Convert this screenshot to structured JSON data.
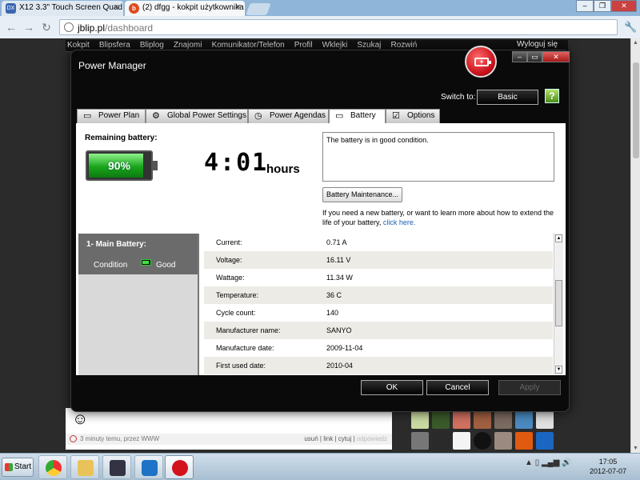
{
  "browser": {
    "tabs": [
      {
        "label": "X12 3.3\" Touch Screen Quad",
        "prefix": "DX"
      },
      {
        "label": "(2) dfgg - kokpit użytkownika"
      }
    ],
    "url_host": "jblip.pl",
    "url_path": "/dashboard"
  },
  "site": {
    "nav": [
      "Kokpit",
      "Blipsfera",
      "Bliplog",
      "Znajomi",
      "Komunikator/Telefon",
      "Profil",
      "Wklejki",
      "Szukaj",
      "Rozwiń"
    ],
    "logout": "Wyloguj się",
    "post": {
      "meta": "3 minuty temu, przez WWW",
      "actions": [
        "usuń",
        "link",
        "cytuj",
        "odpowiedz"
      ]
    }
  },
  "power_manager": {
    "title": "Power Manager",
    "switch_to_label": "Switch to:",
    "switch_button": "Basic",
    "help_icon_glyph": "?",
    "tabs": [
      {
        "label": "Power Plan",
        "icon": "battery-plan-icon"
      },
      {
        "label": "Global Power Settings",
        "icon": "gear-icon"
      },
      {
        "label": "Power Agendas",
        "icon": "agenda-clock-icon"
      },
      {
        "label": "Battery",
        "icon": "battery-icon",
        "active": true
      },
      {
        "label": "Options",
        "icon": "checkbox-icon"
      }
    ],
    "remaining_label": "Remaining battery:",
    "battery_percent": "90%",
    "battery_level": 0.9,
    "time_remaining": "4:01",
    "time_unit": "hours",
    "status_message": "The battery is in good condition.",
    "maintenance_button": "Battery Maintenance...",
    "help_text": "If you need a new battery, or want to learn more about how to extend the life of your battery,",
    "help_link": "click here.",
    "battery": {
      "name": "1- Main Battery:",
      "condition_label": "Condition",
      "condition_value": "Good"
    },
    "properties": [
      {
        "label": "Current:",
        "value": "0.71 A"
      },
      {
        "label": "Voltage:",
        "value": "16.11 V"
      },
      {
        "label": "Wattage:",
        "value": "11.34 W"
      },
      {
        "label": "Temperature:",
        "value": "36 C"
      },
      {
        "label": "Cycle count:",
        "value": "140"
      },
      {
        "label": "Manufacturer name:",
        "value": "SANYO"
      },
      {
        "label": "Manufacture date:",
        "value": "2009-11-04"
      },
      {
        "label": "First used date:",
        "value": "2010-04"
      }
    ],
    "buttons": {
      "ok": "OK",
      "cancel": "Cancel",
      "apply": "Apply"
    }
  },
  "taskbar": {
    "start": "Start",
    "time": "17:05",
    "date": "2012-07-07"
  },
  "colors": {
    "accent_red": "#c8101a",
    "battery_green": "#1aa51c",
    "link_blue": "#1f5fb0"
  }
}
